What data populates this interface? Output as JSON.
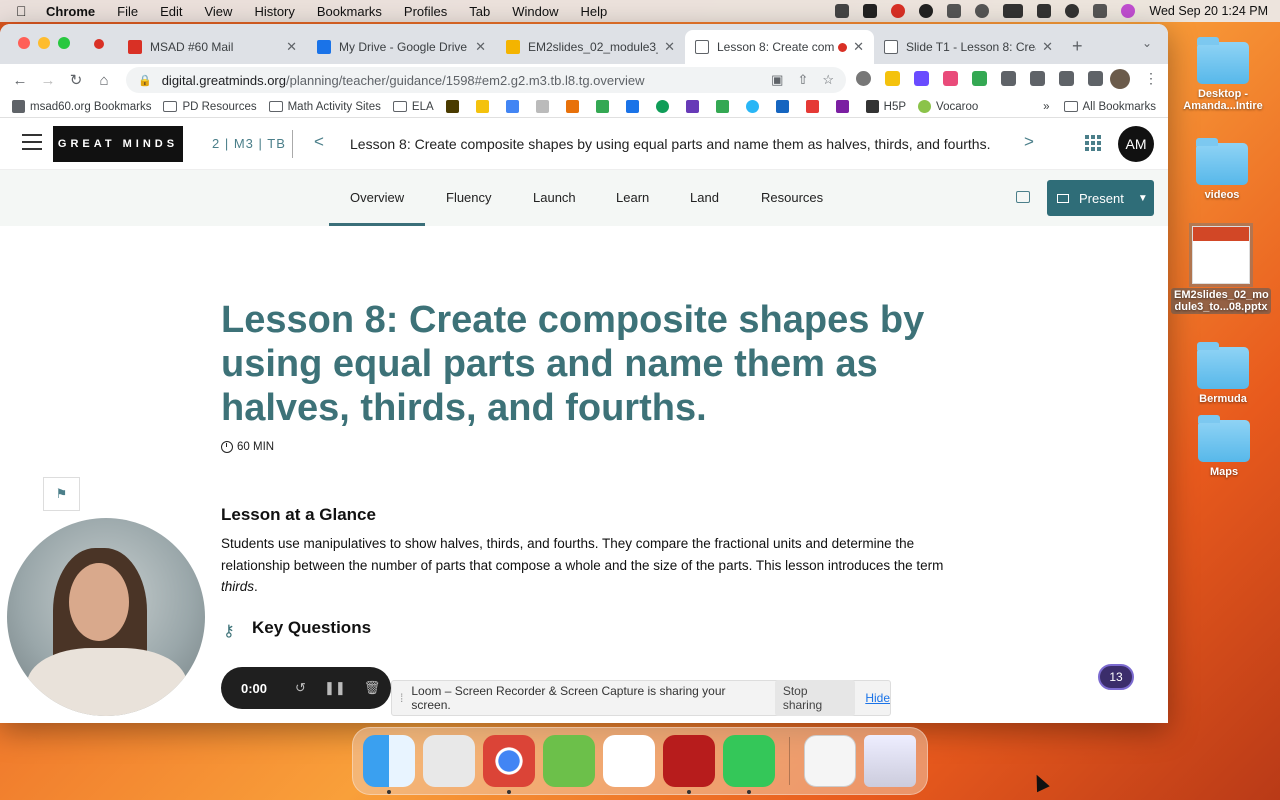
{
  "menubar": {
    "items": [
      "Chrome",
      "File",
      "Edit",
      "View",
      "History",
      "Bookmarks",
      "Profiles",
      "Tab",
      "Window",
      "Help"
    ],
    "clock": "Wed Sep 20  1:24 PM"
  },
  "tabs": [
    {
      "title": "MSAD #60 Mail",
      "favicon_color": "#d93025"
    },
    {
      "title": "My Drive - Google Drive",
      "favicon_color": "#1a73e8"
    },
    {
      "title": "EM2slides_02_module3_",
      "favicon_color": "#f4b400"
    },
    {
      "title": "Lesson 8: Create com",
      "favicon_color": "#5f6368"
    },
    {
      "title": "Slide T1 - Lesson 8: Crea",
      "favicon_color": "#5f6368"
    }
  ],
  "address": {
    "host": "digital.greatminds.org",
    "path": "/planning/teacher/guidance/1598#em2.g2.m3.tb.l8.tg.overview"
  },
  "bookmarks": [
    {
      "label": "msad60.org Bookmarks",
      "type": "folder"
    },
    {
      "label": "PD Resources",
      "type": "folder"
    },
    {
      "label": "Math Activity Sites",
      "type": "folder"
    },
    {
      "label": "ELA",
      "type": "folder"
    },
    {
      "label": "H5P",
      "type": "link"
    },
    {
      "label": "Vocaroo",
      "type": "link"
    }
  ],
  "bookmarks_overflow": "»",
  "bookmarks_all": "All Bookmarks",
  "app": {
    "logo": "GREAT MINDS",
    "breadcrumb": "2 | M3 | TB",
    "lesson_title": "Lesson 8: Create composite shapes by using equal parts and name them as halves, thirds, and fourths.",
    "user_initials": "AM",
    "nav_tabs": [
      "Overview",
      "Fluency",
      "Launch",
      "Learn",
      "Land",
      "Resources"
    ],
    "present_label": "Present"
  },
  "content": {
    "title": "Lesson 8: Create composite shapes by using equal parts and name them as halves, thirds, and fourths.",
    "duration": "60 MIN",
    "glance_heading": "Lesson at a Glance",
    "glance_text_pre": "Students use manipulatives to show halves, thirds, and fourths. They compare the fractional units and determine the relationship between the number of parts that compose a whole and the size of the parts. This lesson introduces the term ",
    "glance_text_em": "thirds",
    "glance_text_post": ".",
    "key_heading": "Key Questions"
  },
  "recorder": {
    "time": "0:00"
  },
  "loom": {
    "message": "Loom – Screen Recorder & Screen Capture is sharing your screen.",
    "stop_label": "Stop sharing",
    "hide_label": "Hide"
  },
  "notification_count": "13",
  "desktop": [
    {
      "label": "Desktop - Amanda...Intire",
      "kind": "folder"
    },
    {
      "label": "videos",
      "kind": "folder"
    },
    {
      "label": "EM2slides_02_mo dule3_to...08.pptx",
      "kind": "pptx"
    },
    {
      "label": "Bermuda",
      "kind": "folder"
    },
    {
      "label": "Maps",
      "kind": "folder"
    }
  ]
}
